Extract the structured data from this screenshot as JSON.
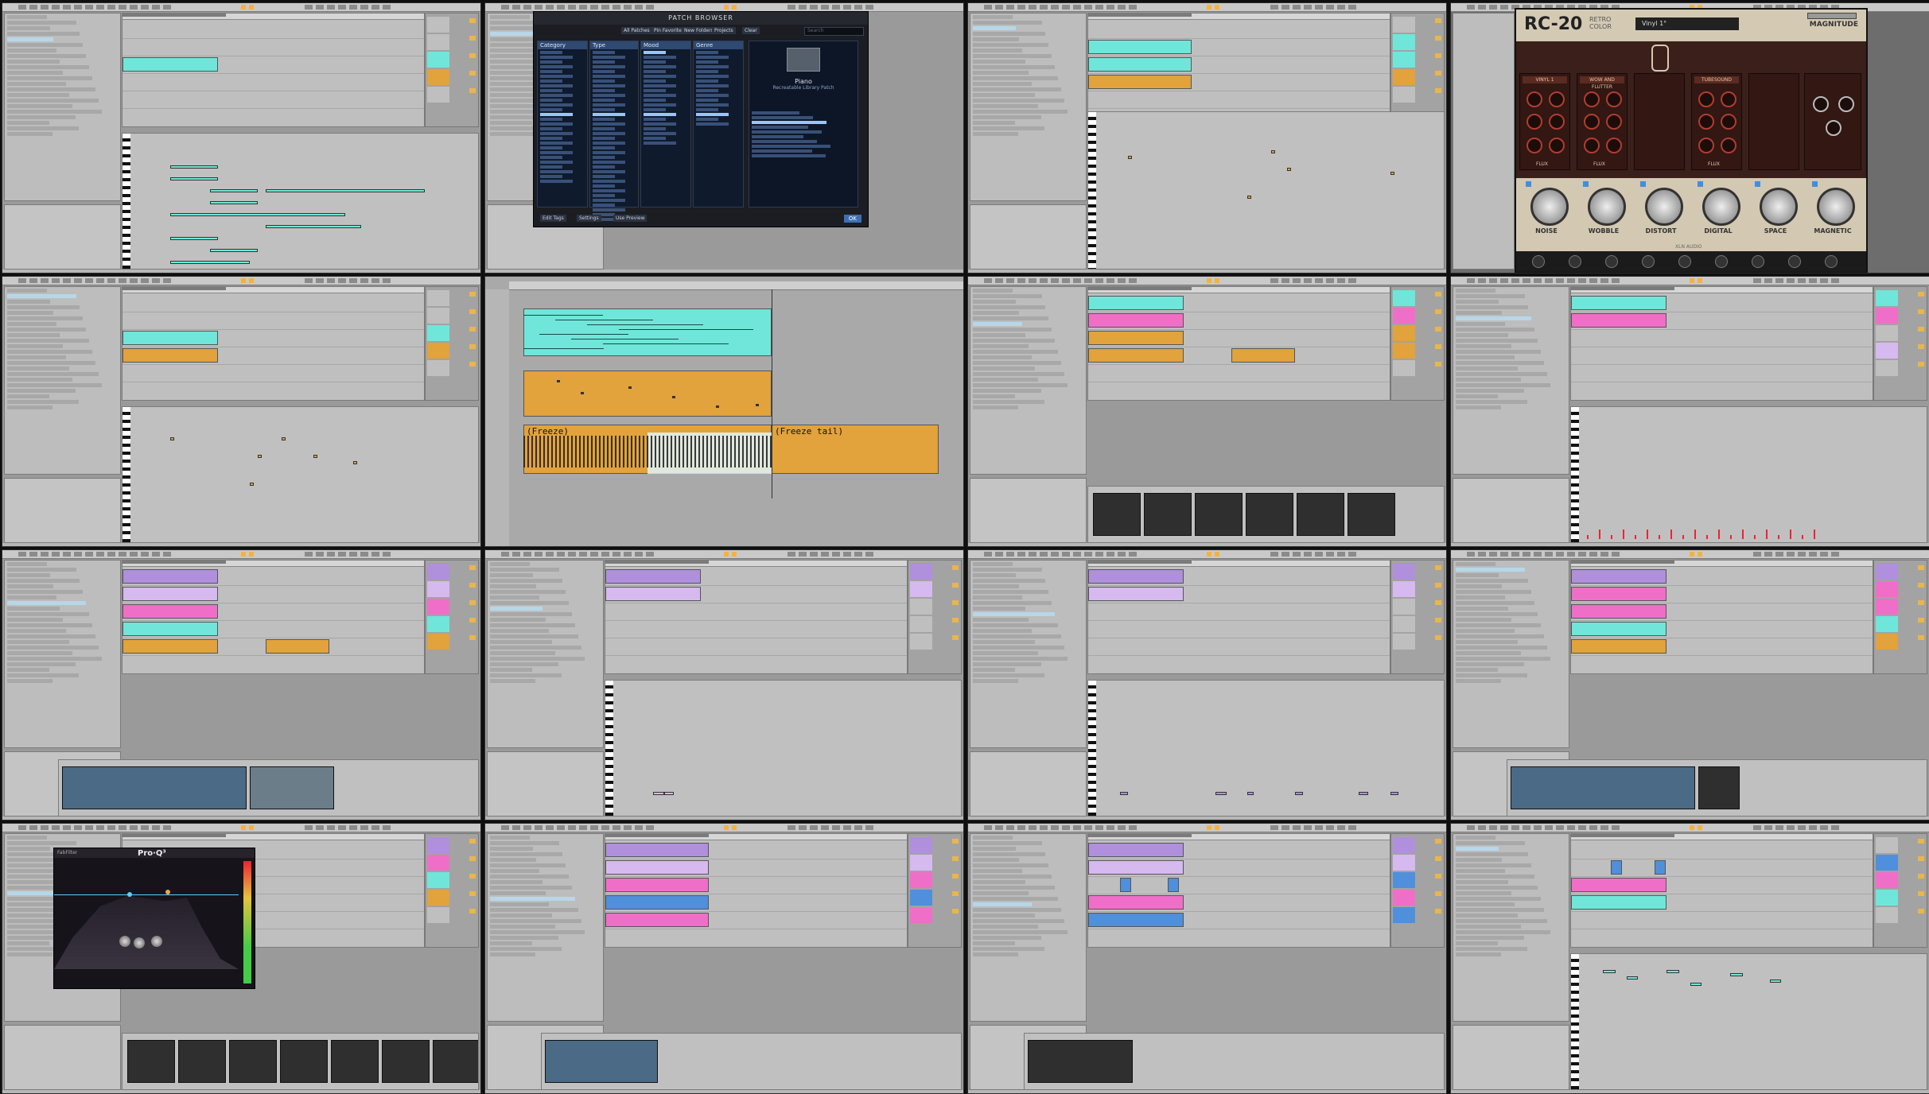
{
  "screen": {
    "layout": "4x4 grid of Ableton Live screenshots"
  },
  "patch_browser": {
    "title": "PATCH BROWSER",
    "columns": [
      "Category",
      "Type",
      "Mood",
      "Genre"
    ],
    "preview_title": "Piano",
    "preview_sub": "Recreatable Library Patch",
    "buttons": [
      "All Patches",
      "Pin Favorites",
      "New Folders",
      "Projects",
      "Clear"
    ],
    "search_placeholder": "Search",
    "footer_buttons": [
      "Edit Tags",
      "Settings",
      "Use Preview"
    ],
    "ok_label": "OK"
  },
  "rc20": {
    "logo": "RC-20",
    "sub1": "RETRO",
    "sub2": "COLOR",
    "preset": "Vinyl 1°",
    "magnitude_label": "MAGNITUDE",
    "modules": [
      "VINYL 1",
      "WOW AND FLUTTER",
      "",
      "TUBESOUND"
    ],
    "module_labels": [
      "FLUX",
      "FLUX",
      "FLUX",
      "FLUX"
    ],
    "big_knobs": [
      "NOISE",
      "WOBBLE",
      "DISTORT",
      "DIGITAL",
      "SPACE",
      "MAGNETIC"
    ],
    "brand": "XLN AUDIO"
  },
  "freeze": {
    "label1": "(Freeze)",
    "label2": "(Freeze tail)"
  },
  "proq": {
    "logo": "Pro·Q³",
    "brand": "FabFilter"
  },
  "colors": {
    "cyan": "#6fe6d9",
    "orange": "#e2a23c",
    "pink": "#ef6fc8",
    "purple": "#b08fdc",
    "lightpurple": "#d6b9ee",
    "blue": "#4f8fdb",
    "green": "#a2e86a",
    "red": "#e6323a",
    "grey": "#bfbfbf"
  }
}
